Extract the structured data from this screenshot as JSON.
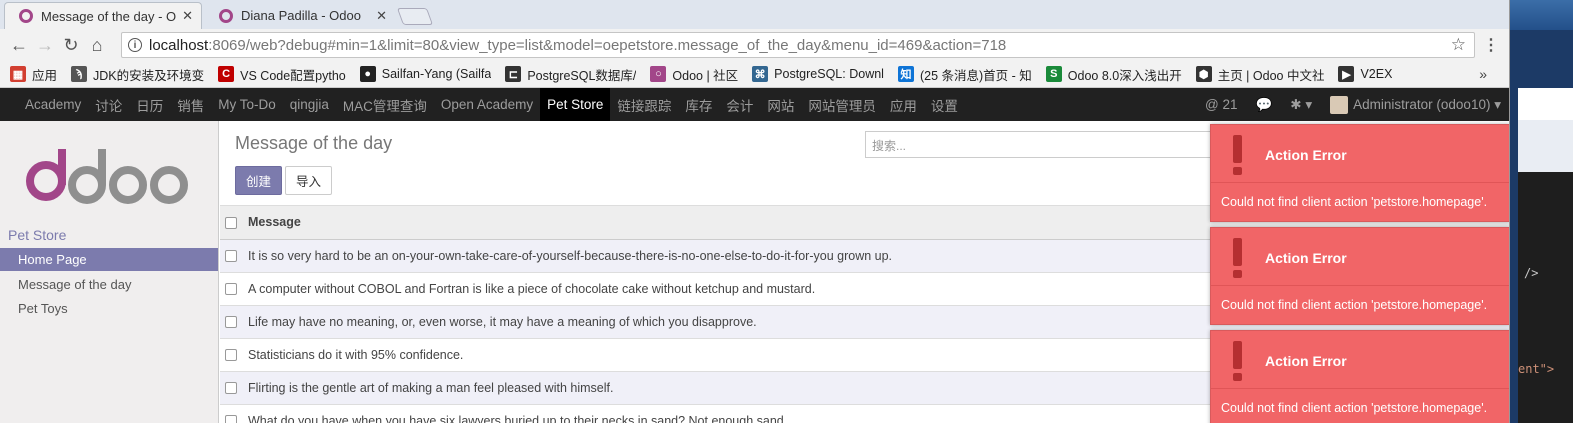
{
  "browser": {
    "tabs": [
      {
        "title": "Message of the day - O",
        "active": true
      },
      {
        "title": "Diana Padilla - Odoo",
        "active": false
      }
    ],
    "url_host": "localhost",
    "url_rest": ":8069/web?debug#min=1&limit=80&view_type=list&model=oepetstore.message_of_the_day&menu_id=469&action=718",
    "bookmarks": [
      {
        "label": "应用",
        "icon": "apps-grid-icon",
        "color": "#d23f31"
      },
      {
        "label": "JDK的安装及环境变",
        "icon": "bookmark-icon",
        "color": "#555555"
      },
      {
        "label": "VS Code配置pytho",
        "icon": "c-icon",
        "color": "#c00000"
      },
      {
        "label": "Sailfan-Yang (Sailfa",
        "icon": "github-icon",
        "color": "#222222"
      },
      {
        "label": "PostgreSQL数据库/",
        "icon": "codeblock-icon",
        "color": "#333333"
      },
      {
        "label": "Odoo | 社区",
        "icon": "odoo-icon",
        "color": "#a24689"
      },
      {
        "label": "PostgreSQL: Downl",
        "icon": "elephant-icon",
        "color": "#336791"
      },
      {
        "label": "(25 条消息)首页 - 知",
        "icon": "zhihu-icon",
        "color": "#0e74d6"
      },
      {
        "label": "Odoo 8.0深入浅出开",
        "icon": "s-icon",
        "color": "#1a8a3a"
      },
      {
        "label": "主页 | Odoo 中文社",
        "icon": "hex-icon",
        "color": "#333333"
      },
      {
        "label": "V2EX",
        "icon": "v2ex-icon",
        "color": "#333333"
      }
    ]
  },
  "odoo_nav": {
    "items": [
      "Academy",
      "讨论",
      "日历",
      "销售",
      "My To-Do",
      "qingjia",
      "MAC管理查询",
      "Open Academy",
      "Pet Store",
      "链接跟踪",
      "库存",
      "会计",
      "网站",
      "网站管理员",
      "应用",
      "设置"
    ],
    "active": "Pet Store",
    "mentions": "21",
    "user": "Administrator (odoo10)"
  },
  "sidebar": {
    "category": "Pet Store",
    "items": [
      "Home Page",
      "Message of the day",
      "Pet Toys"
    ],
    "active": "Home Page"
  },
  "content": {
    "breadcrumb": "Message of the day",
    "create_label": "创建",
    "import_label": "导入",
    "search_placeholder": "搜索...",
    "column_header": "Message",
    "rows": [
      "It is so very hard to be an on-your-own-take-care-of-yourself-because-there-is-no-one-else-to-do-it-for-you grown up.",
      "A computer without COBOL and Fortran is like a piece of chocolate cake without ketchup and mustard.",
      "Life may have no meaning, or, even worse, it may have a meaning of which you disapprove.",
      "Statisticians do it with 95% confidence.",
      "Flirting is the gentle art of making a man feel pleased with himself.",
      "What do you have when you have six lawyers buried up to their necks in sand? Not enough sand."
    ]
  },
  "notifications": [
    {
      "title": "Action Error",
      "message": "Could not find client action 'petstore.homepage'."
    },
    {
      "title": "Action Error",
      "message": "Could not find client action 'petstore.homepage'."
    },
    {
      "title": "Action Error",
      "message": "Could not find client action 'petstore.homepage'."
    }
  ],
  "desktop_code": [
    "/>",
    "ent\">"
  ]
}
